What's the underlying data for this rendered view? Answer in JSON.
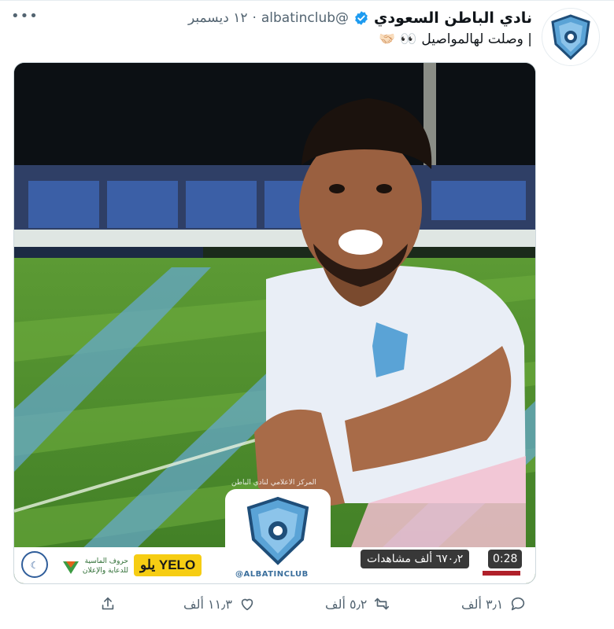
{
  "tweet": {
    "display_name": "نادي الباطن السعودي",
    "handle": "@albatinclub",
    "separator": "·",
    "date": "١٢ ديسمبر",
    "text": "| وصلت لهالمواصيل",
    "text_emoji": "👀",
    "trailing_emoji": "🤝🏻"
  },
  "media": {
    "duration": "0:28",
    "views": "٦٧٠٫٢ ألف مشاهدات",
    "club_handle": "@ALBATINCLUB",
    "watermark": "المركز الاعلامي لنادي الباطن",
    "sponsors": {
      "yelo": "يلو YELO",
      "almasia": "حروف الماسية للدعاية والإعلان"
    }
  },
  "actions": {
    "replies": "٣٫١ ألف",
    "retweets": "٥٫٢ ألف",
    "likes": "١١٫٣ ألف"
  },
  "colors": {
    "verified": "#1d9bf0",
    "secondary_text": "#536471",
    "club_blue": "#5aa3d6"
  }
}
